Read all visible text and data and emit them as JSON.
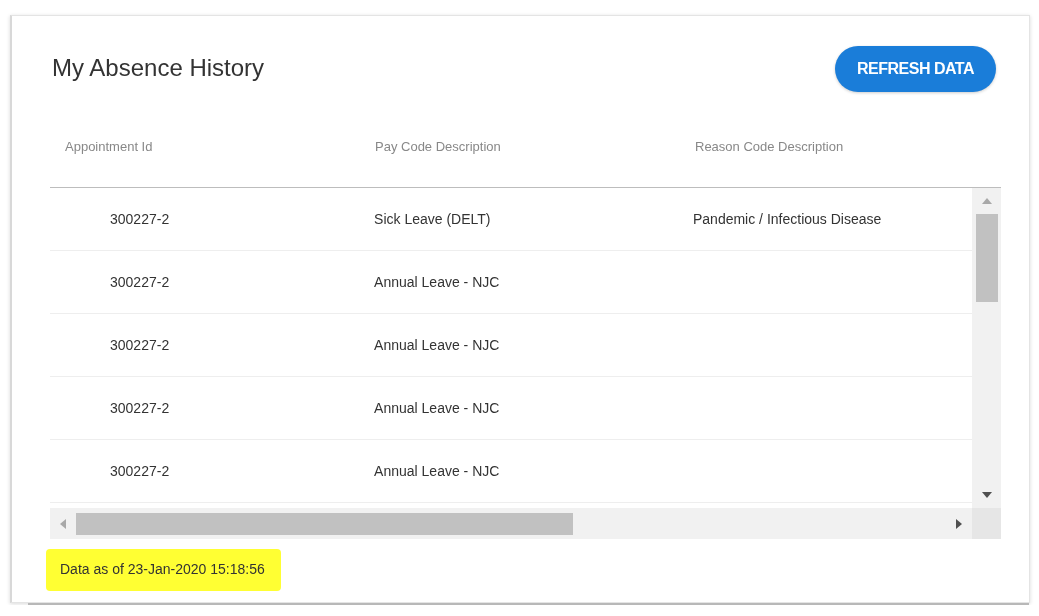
{
  "card": {
    "title": "My Absence History",
    "refresh_button": "REFRESH DATA"
  },
  "table": {
    "columns": [
      "Appointment Id",
      "Pay Code Description",
      "Reason Code Description"
    ],
    "rows": [
      {
        "appointment_id": "300227-2",
        "pay_code_description": "Sick Leave (DELT)",
        "reason_code_description": "Pandemic / Infectious Disease"
      },
      {
        "appointment_id": "300227-2",
        "pay_code_description": "Annual Leave - NJC"
      },
      {
        "appointment_id": "300227-2",
        "pay_code_description": "Annual Leave - NJC"
      },
      {
        "appointment_id": "300227-2",
        "pay_code_description": "Annual Leave - NJC"
      },
      {
        "appointment_id": "300227-2",
        "pay_code_description": "Annual Leave - NJC"
      }
    ]
  },
  "footer": {
    "data_timestamp": "Data as of 23-Jan-2020 15:18:56"
  }
}
